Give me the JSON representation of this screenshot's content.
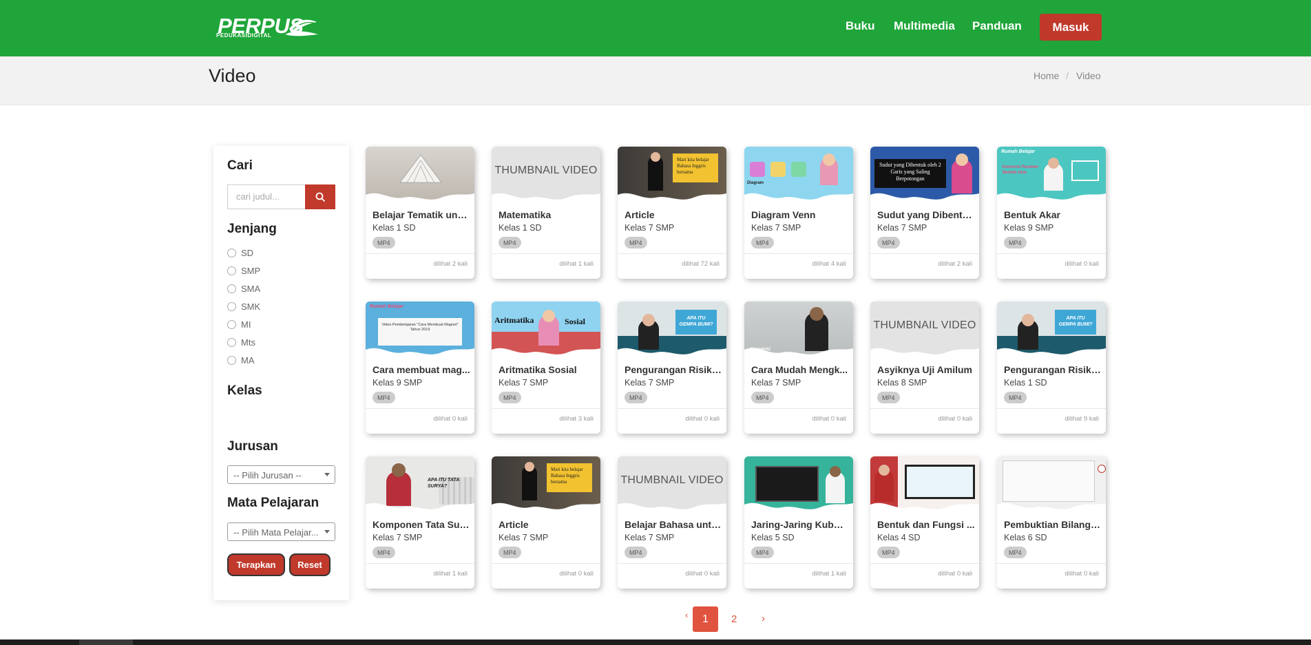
{
  "header": {
    "logo": "PERPUS",
    "logo_sub": "PEDUKASIDIGITAL",
    "nav": [
      "Buku",
      "Multimedia",
      "Panduan"
    ],
    "login": "Masuk"
  },
  "page": {
    "title": "Video",
    "breadcrumb": [
      "Home",
      "/",
      "Video"
    ]
  },
  "sidebar": {
    "search_heading": "Cari",
    "search_placeholder": "cari judul...",
    "level_heading": "Jenjang",
    "levels": [
      "SD",
      "SMP",
      "SMA",
      "SMK",
      "MI",
      "Mts",
      "MA"
    ],
    "class_heading": "Kelas",
    "major_heading": "Jurusan",
    "major_select": "-- Pilih Jurusan --",
    "subject_heading": "Mata Pelajaran",
    "subject_select": "-- Pilih Mata Pelajar...",
    "apply": "Terapkan",
    "reset": "Reset"
  },
  "videos": [
    {
      "title": "Belajar Tematik untu...",
      "class": "Kelas 1 SD",
      "format": "MP4",
      "views": "dilihat 2 kali",
      "thumb": "book"
    },
    {
      "title": "Matematika",
      "class": "Kelas 1 SD",
      "format": "MP4",
      "views": "dilihat 1 kali",
      "thumb": "placeholder"
    },
    {
      "title": "Article",
      "class": "Kelas 7 SMP",
      "format": "MP4",
      "views": "dilihat 72 kali",
      "thumb": "studio"
    },
    {
      "title": "Diagram Venn",
      "class": "Kelas 7 SMP",
      "format": "MP4",
      "views": "dilihat 4 kali",
      "thumb": "venn"
    },
    {
      "title": "Sudut yang Dibentu...",
      "class": "Kelas 7 SMP",
      "format": "MP4",
      "views": "dilihat 2 kali",
      "thumb": "chalkboard"
    },
    {
      "title": "Bentuk Akar",
      "class": "Kelas 9 SMP",
      "format": "MP4",
      "views": "dilihat 0 kali",
      "thumb": "rumah-teal"
    },
    {
      "title": "Cara membuat mag...",
      "class": "Kelas 9 SMP",
      "format": "MP4",
      "views": "dilihat 0 kali",
      "thumb": "blue-slide"
    },
    {
      "title": "Aritmatika Sosial",
      "class": "Kelas 7 SMP",
      "format": "MP4",
      "views": "dilihat 3 kali",
      "thumb": "aritmatika"
    },
    {
      "title": "Pengurangan Risiko...",
      "class": "Kelas 7 SMP",
      "format": "MP4",
      "views": "dilihat 0 kali",
      "thumb": "gempa"
    },
    {
      "title": "Cara Mudah Mengk...",
      "class": "Kelas 7 SMP",
      "format": "MP4",
      "views": "dilihat 0 kali",
      "thumb": "konversi"
    },
    {
      "title": "Asyiknya Uji Amilum",
      "class": "Kelas 8 SMP",
      "format": "MP4",
      "views": "dilihat 0 kali",
      "thumb": "placeholder"
    },
    {
      "title": "Pengurangan Risiko...",
      "class": "Kelas 1 SD",
      "format": "MP4",
      "views": "dilihat 9 kali",
      "thumb": "gempa"
    },
    {
      "title": "Komponen Tata Surya",
      "class": "Kelas 7 SMP",
      "format": "MP4",
      "views": "dilihat 1 kali",
      "thumb": "tatasurya"
    },
    {
      "title": "Article",
      "class": "Kelas 7 SMP",
      "format": "MP4",
      "views": "dilihat 0 kali",
      "thumb": "studio"
    },
    {
      "title": "Belajar Bahasa untu...",
      "class": "Kelas 7 SMP",
      "format": "MP4",
      "views": "dilihat 0 kali",
      "thumb": "placeholder"
    },
    {
      "title": "Jaring-Jaring Kubus...",
      "class": "Kelas 5 SD",
      "format": "MP4",
      "views": "dilihat 1 kali",
      "thumb": "blackboard"
    },
    {
      "title": "Bentuk dan Fungsi ...",
      "class": "Kelas 4 SD",
      "format": "MP4",
      "views": "dilihat 0 kali",
      "thumb": "redscreen"
    },
    {
      "title": "Pembuktian Bilanga...",
      "class": "Kelas 6 SD",
      "format": "MP4",
      "views": "dilihat 0 kali",
      "thumb": "whiteboard"
    }
  ],
  "thumb_placeholder_text": "THUMBNAIL VIDEO",
  "thumb_texts": {
    "studio": "Mari kita belajar Bahasa Inggris bersama",
    "venn": "Diagram",
    "chalkboard": "Sudut yang Dibentuk oleh 2 Garis yang Saling Berpotongan",
    "rumah_title": "Rumah Belajar",
    "rumah_sub": "Konversi Pecahan Bentuk Akar",
    "blue_title": "Video Pembelajaran \"Cara Membuat Magnet\"",
    "blue_sub": "Tahun 2019",
    "aritmatika_a": "Aritmatika",
    "aritmatika_b": "Sosial",
    "gempa": "APA ITU GEMPA BUMI?",
    "konversi": "Konversi",
    "tatasurya": "APA ITU TATA SURYA?"
  },
  "pagination": {
    "prev": "‹",
    "pages": [
      "1",
      "2"
    ],
    "active": "1",
    "next": "›"
  },
  "colors": {
    "primary": "#1fa539",
    "accent": "#c0392b",
    "page_active": "#e0533f"
  }
}
